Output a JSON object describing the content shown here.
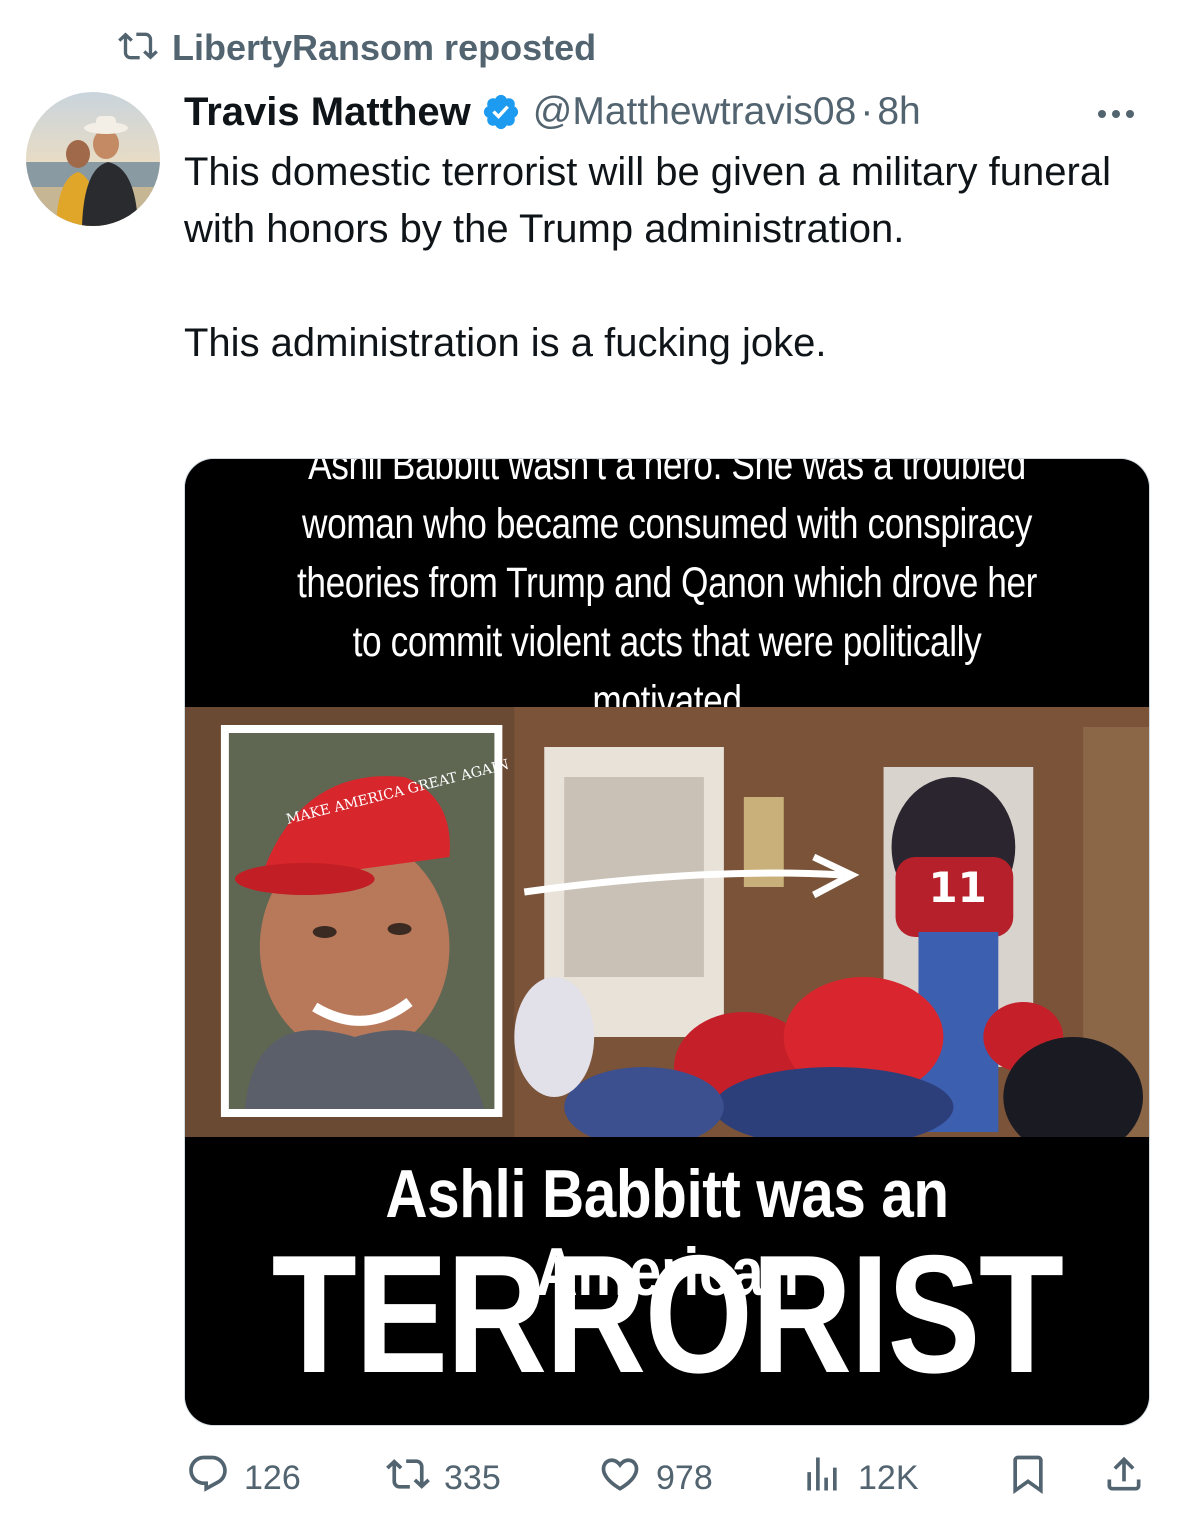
{
  "repost": {
    "icon": "retweet-icon",
    "text": "LibertyRansom reposted"
  },
  "author": {
    "name": "Travis Matthew",
    "verified_icon": "verified-badge-icon",
    "handle": "@Matthewtravis08",
    "separator": "·",
    "time": "8h",
    "more_icon": "more-options-icon"
  },
  "tweet": {
    "paragraph1": "This domestic terrorist will be given a military funeral with honors by the Trump administration.",
    "paragraph2": "This administration is a fucking joke."
  },
  "media": {
    "top_caption": "Ashli Babbitt wasn’t a hero. She was a troubled woman who became consumed with conspiracy theories from Trump and Qanon which drove her to commit violent acts that were politically motivated",
    "hat_text": "MAKE AMERICA GREAT AGAIN",
    "jersey_number": "11",
    "bottom_line1": "Ashli Babbitt was an American",
    "bottom_line2": "TERRORIST"
  },
  "actions": {
    "replies": "126",
    "reposts": "335",
    "likes": "978",
    "views": "12K"
  },
  "colors": {
    "text_primary": "#0f1419",
    "text_secondary": "#536471",
    "verified_blue": "#1d9bf0",
    "caption_bg": "#000000"
  }
}
